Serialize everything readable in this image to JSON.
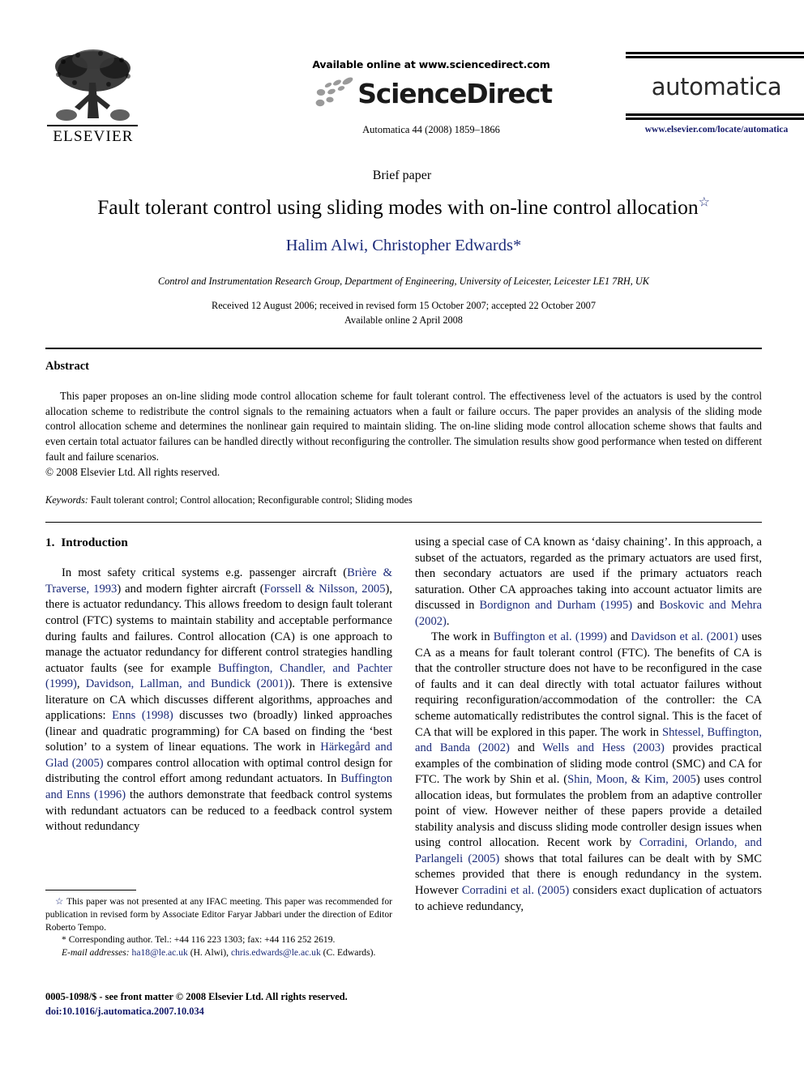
{
  "header": {
    "publisher_logo_label": "ELSEVIER",
    "available_online": "Available online at www.sciencedirect.com",
    "sciencedirect_wordmark": "ScienceDirect",
    "journal_citation_line": "Automatica 44 (2008) 1859–1866",
    "journal_title": "automatica",
    "journal_url": "www.elsevier.com/locate/automatica"
  },
  "title_block": {
    "article_type": "Brief paper",
    "title": "Fault tolerant control using sliding modes with on-line control allocation",
    "title_footnote_marker": "☆",
    "authors": "Halim Alwi, Christopher Edwards",
    "corresponding_marker": "*",
    "affiliation": "Control and Instrumentation Research Group, Department of Engineering, University of Leicester, Leicester LE1 7RH, UK",
    "received_line": "Received 12 August 2006; received in revised form 15 October 2007; accepted 22 October 2007",
    "available_online_line": "Available online 2 April 2008"
  },
  "abstract": {
    "heading": "Abstract",
    "paragraph": "This paper proposes an on-line sliding mode control allocation scheme for fault tolerant control. The effectiveness level of the actuators is used by the control allocation scheme to redistribute the control signals to the remaining actuators when a fault or failure occurs. The paper provides an analysis of the sliding mode control allocation scheme and determines the nonlinear gain required to maintain sliding. The on-line sliding mode control allocation scheme shows that faults and even certain total actuator failures can be handled directly without reconfiguring the controller. The simulation results show good performance when tested on different fault and failure scenarios.",
    "copyright": "© 2008 Elsevier Ltd. All rights reserved."
  },
  "keywords": {
    "label": "Keywords:",
    "list": "Fault tolerant control; Control allocation; Reconfigurable control; Sliding modes"
  },
  "body": {
    "section1": {
      "number": "1.",
      "heading": "Introduction"
    },
    "left_column": {
      "para1_a": "In most safety critical systems e.g. passenger aircraft (",
      "cite1": "Brière & Traverse, 1993",
      "para1_b": ") and modern fighter aircraft (",
      "cite2": "Forssell & Nilsson, 2005",
      "para1_c": "), there is actuator redundancy. This allows freedom to design fault tolerant control (FTC) systems to maintain stability and acceptable performance during faults and failures. Control allocation (CA) is one approach to manage the actuator redundancy for different control strategies handling actuator faults (see for example ",
      "cite3": "Buffington, Chandler, and Pachter (1999)",
      "para1_d": ", ",
      "cite4": "Davidson, Lallman, and Bundick (2001)",
      "para1_e": "). There is extensive literature on CA which discusses different algorithms, approaches and applications: ",
      "cite5": "Enns (1998)",
      "para1_f": " discusses two (broadly) linked approaches (linear and quadratic programming) for CA based on finding the ‘best solution’ to a system of linear equations. The work in ",
      "cite6": "Härkegård and Glad (2005)",
      "para1_g": " compares control allocation with optimal control design for distributing the control effort among redundant actuators. In ",
      "cite7": "Buffington and Enns (1996)",
      "para1_h": " the authors demonstrate that feedback control systems with redundant actuators can be reduced to a feedback control system without redundancy"
    },
    "right_column": {
      "para1_a": "using a special case of CA known as ‘daisy chaining’. In this approach, a subset of the actuators, regarded as the primary actuators are used first, then secondary actuators are used if the primary actuators reach saturation. Other CA approaches taking into account actuator limits are discussed in ",
      "cite1": "Bordignon and Durham (1995)",
      "para1_b": " and ",
      "cite2": "Boskovic and Mehra (2002)",
      "para1_c": ".",
      "para2_a": "The work in ",
      "cite3": "Buffington et al. (1999)",
      "para2_b": " and ",
      "cite4": "Davidson et al. (2001)",
      "para2_c": " uses CA as a means for fault tolerant control (FTC). The benefits of CA is that the controller structure does not have to be reconfigured in the case of faults and it can deal directly with total actuator failures without requiring reconfiguration/accommodation of the controller: the CA scheme automatically redistributes the control signal. This is the facet of CA that will be explored in this paper. The work in ",
      "cite5": "Shtessel, Buffington, and Banda (2002)",
      "para2_d": " and ",
      "cite6": "Wells and Hess (2003)",
      "para2_e": " provides practical examples of the combination of sliding mode control (SMC) and CA for FTC. The work by Shin et al. (",
      "cite7": "Shin, Moon, & Kim, 2005",
      "para2_f": ") uses control allocation ideas, but formulates the problem from an adaptive controller point of view. However neither of these papers provide a detailed stability analysis and discuss sliding mode controller design issues when using control allocation. Recent work by ",
      "cite8": "Corradini, Orlando, and Parlangeli (2005)",
      "para2_g": " shows that total failures can be dealt with by SMC schemes provided that there is enough redundancy in the system. However ",
      "cite9": "Corradini et al. (2005)",
      "para2_h": " considers exact duplication of actuators to achieve redundancy,"
    }
  },
  "footnotes": {
    "star_marker": "☆",
    "star_text": "This paper was not presented at any IFAC meeting. This paper was recommended for publication in revised form by Associate Editor Faryar Jabbari under the direction of Editor Roberto Tempo.",
    "corresponding_marker": "*",
    "corresponding_text": "Corresponding author. Tel.: +44 116 223 1303; fax: +44 116 252 2619.",
    "email_label": "E-mail addresses:",
    "email1": "ha18@le.ac.uk",
    "email1_owner": "(H. Alwi),",
    "email2": "chris.edwards@le.ac.uk",
    "email2_owner": "(C. Edwards)."
  },
  "publisher_footer": {
    "front_matter": "0005-1098/$ - see front matter © 2008 Elsevier Ltd. All rights reserved.",
    "doi": "doi:10.1016/j.automatica.2007.10.034"
  },
  "colors": {
    "link": "#1b2a78",
    "doi_link": "#151b6b",
    "text": "#000000"
  }
}
